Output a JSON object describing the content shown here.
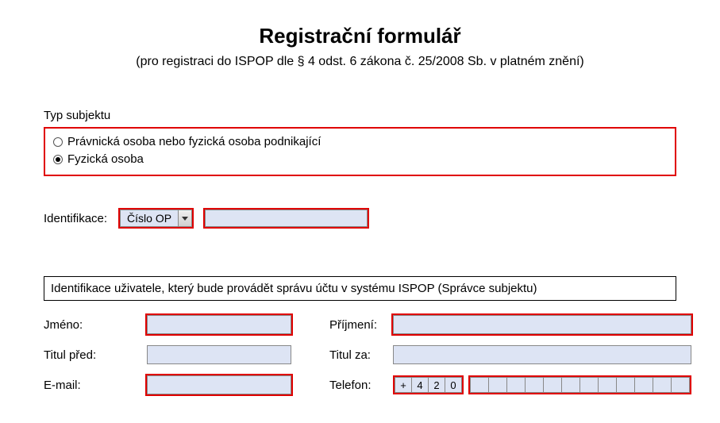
{
  "title": "Registrační formulář",
  "subtitle": "(pro registraci do ISPOP dle  § 4 odst. 6 zákona č. 25/2008 Sb. v platném znění)",
  "subject_type": {
    "label": "Typ subjektu",
    "options": [
      {
        "label": "Právnická osoba nebo fyzická osoba podnikající",
        "selected": false
      },
      {
        "label": "Fyzická osoba",
        "selected": true
      }
    ]
  },
  "identification": {
    "label": "Identifikace:",
    "select_value": "Číslo OP",
    "number_value": ""
  },
  "user_section": {
    "heading": "Identifikace uživatele, který bude provádět správu účtu v systému ISPOP (Správce subjektu)",
    "labels": {
      "jmeno": "Jméno:",
      "prijmeni": "Příjmení:",
      "titul_pred": "Titul před:",
      "titul_za": "Titul za:",
      "email": "E-mail:",
      "telefon": "Telefon:"
    },
    "values": {
      "jmeno": "",
      "prijmeni": "",
      "titul_pred": "",
      "titul_za": "",
      "email": ""
    },
    "phone": {
      "prefix": [
        "+",
        "4",
        "2",
        "0"
      ],
      "rest_cells": 12
    }
  }
}
